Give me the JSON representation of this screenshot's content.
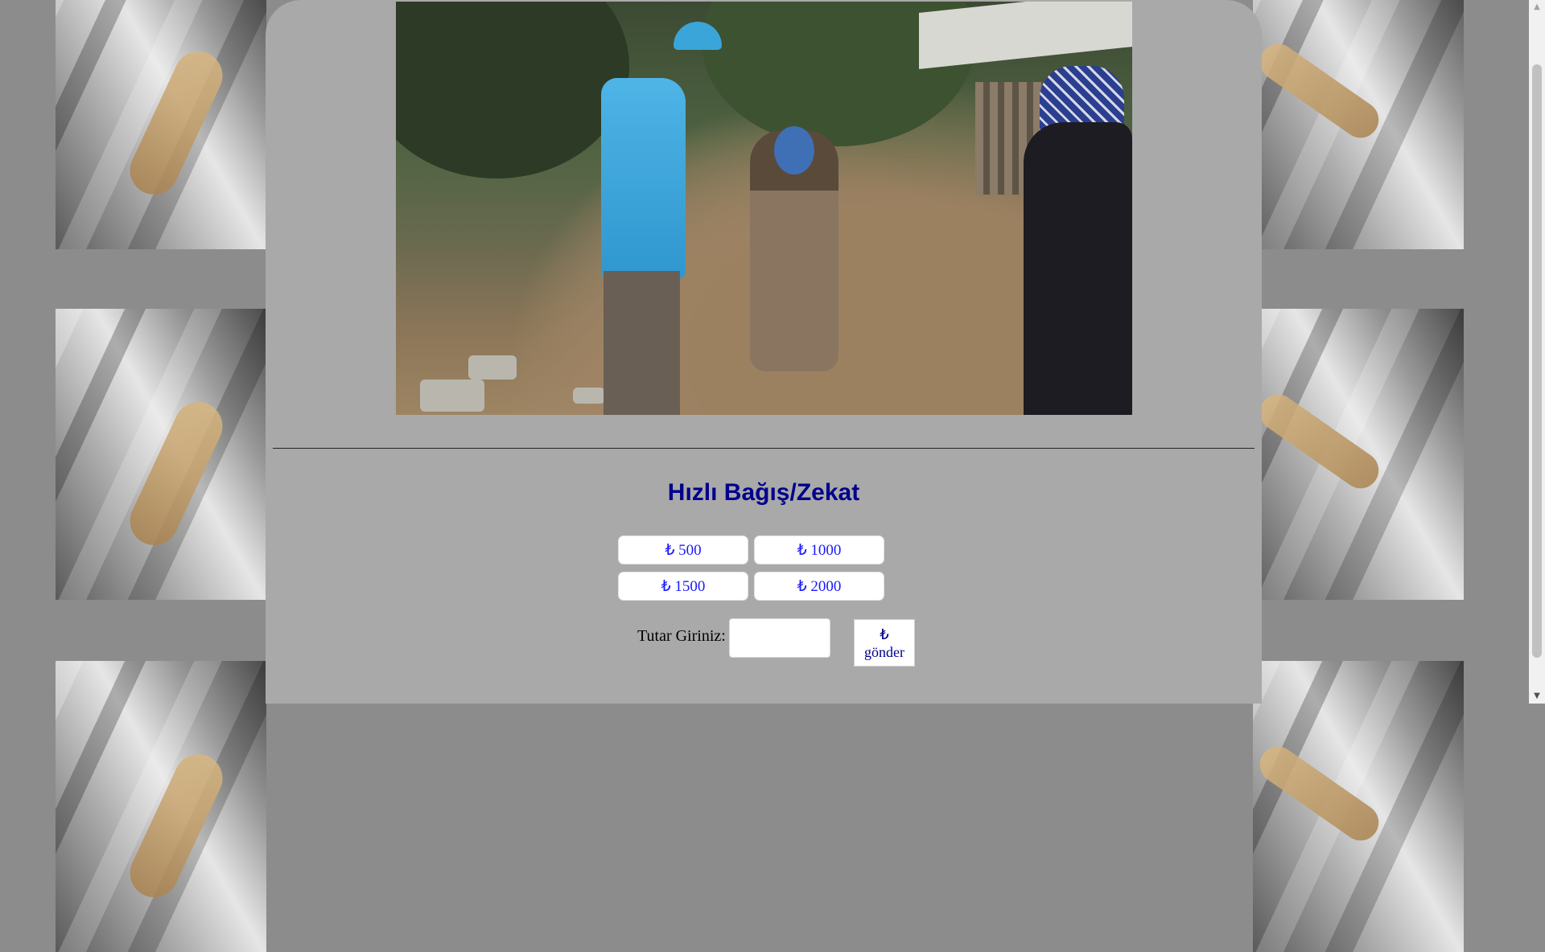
{
  "donation": {
    "title": "Hızlı Bağış/Zekat",
    "amounts": [
      "₺ 500",
      "₺ 1000",
      "₺ 1500",
      "₺ 2000"
    ],
    "input_label": "Tutar Giriniz:",
    "input_value": "",
    "send_currency": "₺",
    "send_label": "gönder"
  },
  "hero": {
    "description": "photo-diyanet-vakfi-volunteer-greeting-elderly-woman"
  },
  "colors": {
    "page_background": "#8c8c8c",
    "panel_background": "#a9a9a9",
    "title": "#00008b",
    "amount_text": "#1a1aff"
  },
  "icons": {
    "scroll_up": "scroll-up-arrow-icon",
    "scroll_down": "scroll-down-arrow-icon"
  }
}
